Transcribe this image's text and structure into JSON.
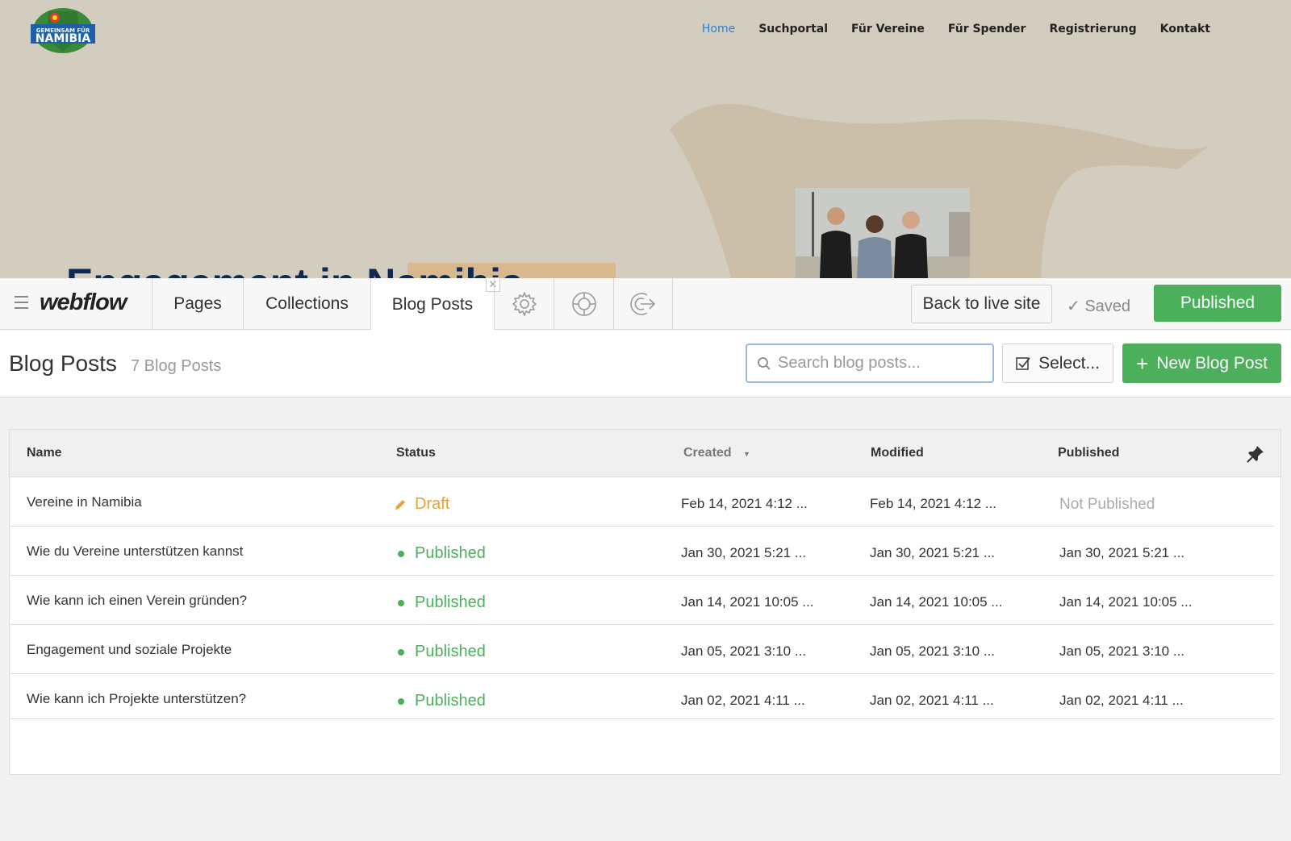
{
  "site": {
    "logo_line1": "GEMEINSAM FÜR",
    "logo_line2": "NAMIBIA",
    "nav": [
      "Home",
      "Suchportal",
      "Für Vereine",
      "Für Spender",
      "Registrierung",
      "Kontakt"
    ],
    "heading": "Engagement in Namibia"
  },
  "editor": {
    "logo": "webflow",
    "tabs": [
      "Pages",
      "Collections",
      "Blog Posts"
    ],
    "active_tab": "Blog Posts",
    "icon_tabs": [
      "gear-icon",
      "lifebuoy-icon",
      "exit-icon"
    ],
    "back_button": "Back to live site",
    "saved": "Saved",
    "publish_button": "Published",
    "colors": {
      "accent": "#4caf5c",
      "draft": "#e4a23a",
      "link": "#2f7fd1"
    }
  },
  "content": {
    "title": "Blog Posts",
    "count": "7 Blog Posts",
    "search_placeholder": "Search blog posts...",
    "select_button": "Select...",
    "new_button": "New Blog Post"
  },
  "table": {
    "columns": [
      "Name",
      "Status",
      "Created",
      "Modified",
      "Published"
    ],
    "sorted_column": "Created",
    "rows": [
      {
        "name": "Vereine in Namibia",
        "status": "Draft",
        "created": "Feb 14, 2021 4:12 ...",
        "modified": "Feb 14, 2021 4:12 ...",
        "published": "Not Published"
      },
      {
        "name": "Wie du Vereine unterstützen kannst",
        "status": "Published",
        "created": "Jan 30, 2021 5:21 ...",
        "modified": "Jan 30, 2021 5:21 ...",
        "published": "Jan 30, 2021 5:21 ..."
      },
      {
        "name": "Wie kann ich einen Verein gründen?",
        "status": "Published",
        "created": "Jan 14, 2021 10:05 ...",
        "modified": "Jan 14, 2021 10:05 ...",
        "published": "Jan 14, 2021 10:05 ..."
      },
      {
        "name": "Engagement und soziale Projekte",
        "status": "Published",
        "created": "Jan 05, 2021 3:10 ...",
        "modified": "Jan 05, 2021 3:10 ...",
        "published": "Jan 05, 2021 3:10 ..."
      },
      {
        "name": "Wie kann ich Projekte unterstützen?",
        "status": "Published",
        "created": "Jan 02, 2021 4:11 ...",
        "modified": "Jan 02, 2021 4:11 ...",
        "published": "Jan 02, 2021 4:11 ..."
      }
    ]
  }
}
